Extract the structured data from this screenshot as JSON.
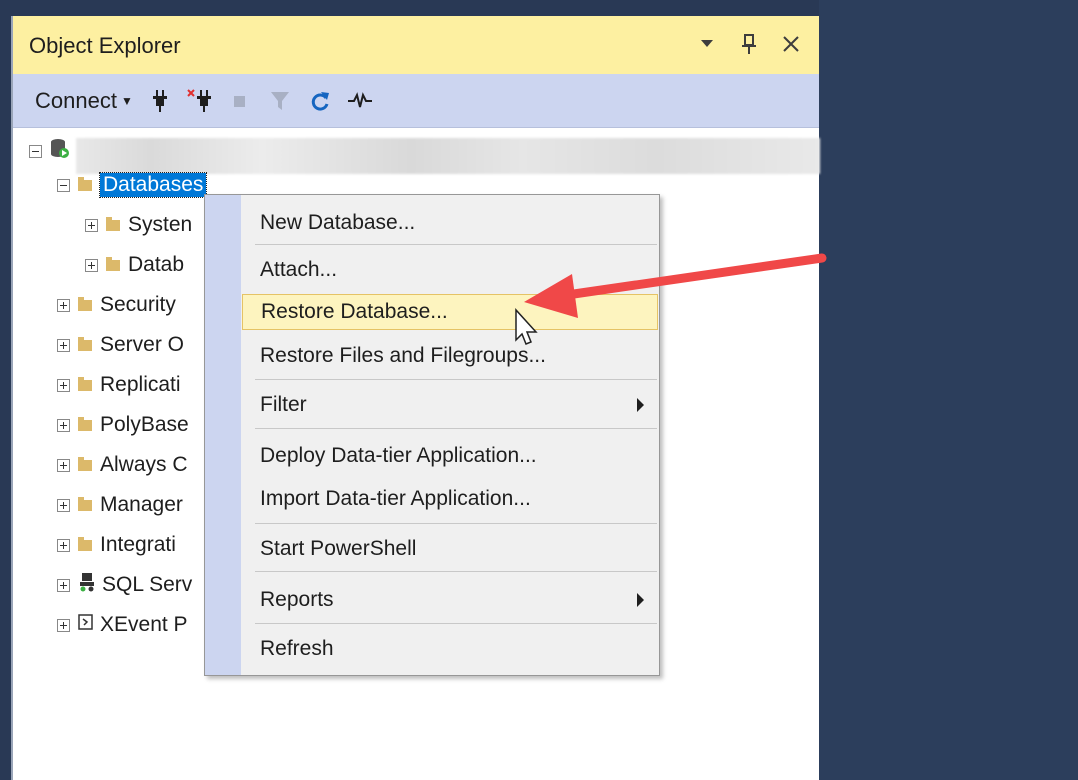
{
  "window": {
    "title": "Object Explorer",
    "controls": [
      "dropdown-icon",
      "pin-icon",
      "close-icon"
    ]
  },
  "toolbar": {
    "connect_label": "Connect",
    "icons": [
      "connect-plug-icon",
      "disconnect-plug-icon",
      "stop-icon",
      "filter-icon",
      "refresh-icon",
      "activity-monitor-icon"
    ]
  },
  "tree": {
    "items": [
      {
        "label": "Databases",
        "expanded": true,
        "selected": true
      },
      {
        "label": "Systen"
      },
      {
        "label": "Datab"
      },
      {
        "label": "Security"
      },
      {
        "label": "Server O"
      },
      {
        "label": "Replicati"
      },
      {
        "label": "PolyBase"
      },
      {
        "label": "Always C"
      },
      {
        "label": "Manager"
      },
      {
        "label": "Integrati"
      },
      {
        "label": "SQL Serv"
      },
      {
        "label": "XEvent P"
      }
    ]
  },
  "context_menu": {
    "items": [
      {
        "label": "New Database..."
      },
      {
        "label": "Attach..."
      },
      {
        "label": "Restore Database...",
        "highlighted": true
      },
      {
        "label": "Restore Files and Filegroups..."
      },
      {
        "label": "Filter",
        "submenu": true
      },
      {
        "label": "Deploy Data-tier Application..."
      },
      {
        "label": "Import Data-tier Application..."
      },
      {
        "label": "Start PowerShell"
      },
      {
        "label": "Reports",
        "submenu": true
      },
      {
        "label": "Refresh"
      }
    ]
  },
  "colors": {
    "title_bar": "#fdf0a1",
    "toolbar": "#ccd5f0",
    "selection": "#0078d7",
    "menu_highlight": "#fdf4bf",
    "annotation_arrow": "#f04848",
    "frame": "#293955"
  }
}
